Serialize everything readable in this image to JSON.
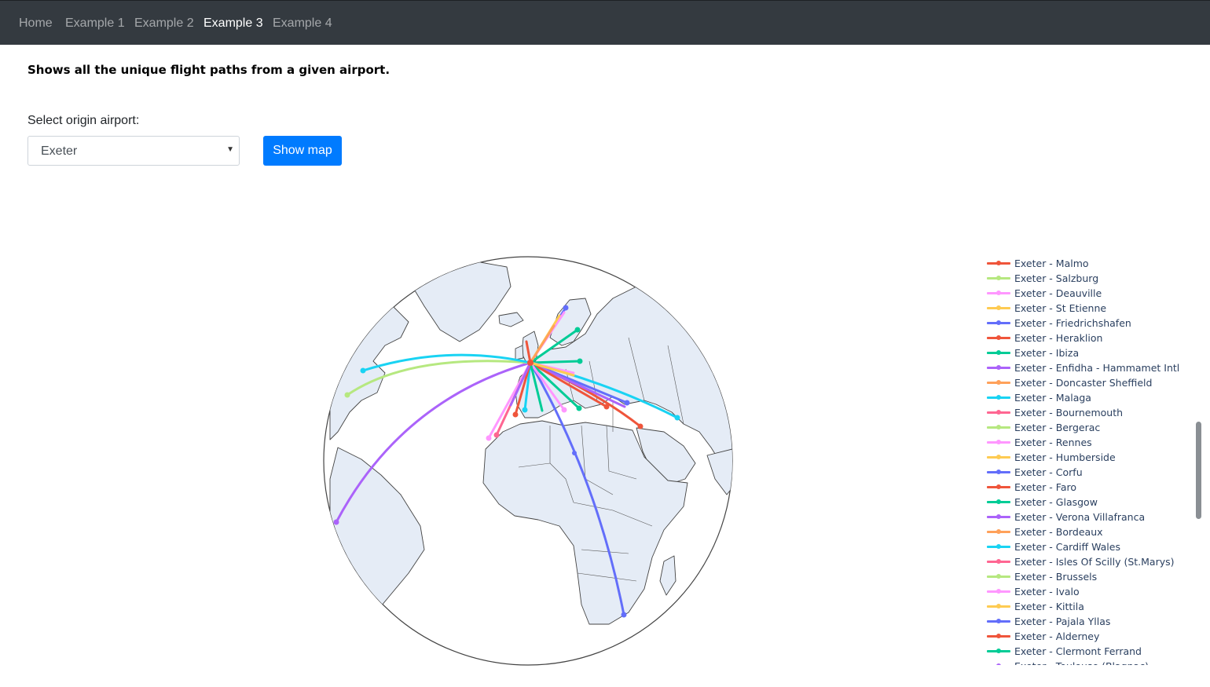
{
  "nav": {
    "items": [
      "Home",
      "Example 1",
      "Example 2",
      "Example 3",
      "Example 4"
    ],
    "active": "Example 3"
  },
  "page": {
    "description": "Shows all the unique flight paths from a given airport.",
    "select_label": "Select origin airport:",
    "select_value": "Exeter",
    "button_label": "Show map"
  },
  "map": {
    "projection": "orthographic",
    "land_color": "#e5ecf6",
    "border_color": "#444444",
    "origin": "Exeter"
  },
  "legend": {
    "items": [
      {
        "label": "Exeter - Malmo",
        "color": "#ef553b"
      },
      {
        "label": "Exeter - Salzburg",
        "color": "#b6e880"
      },
      {
        "label": "Exeter - Deauville",
        "color": "#ff97ff"
      },
      {
        "label": "Exeter - St Etienne",
        "color": "#fecb52"
      },
      {
        "label": "Exeter - Friedrichshafen",
        "color": "#636efa"
      },
      {
        "label": "Exeter - Heraklion",
        "color": "#ef553b"
      },
      {
        "label": "Exeter - Ibiza",
        "color": "#00cc96"
      },
      {
        "label": "Exeter - Enfidha - Hammamet Intl",
        "color": "#ab63fa"
      },
      {
        "label": "Exeter - Doncaster Sheffield",
        "color": "#ffa15a"
      },
      {
        "label": "Exeter - Malaga",
        "color": "#19d3f3"
      },
      {
        "label": "Exeter - Bournemouth",
        "color": "#ff6692"
      },
      {
        "label": "Exeter - Bergerac",
        "color": "#b6e880"
      },
      {
        "label": "Exeter - Rennes",
        "color": "#ff97ff"
      },
      {
        "label": "Exeter - Humberside",
        "color": "#fecb52"
      },
      {
        "label": "Exeter - Corfu",
        "color": "#636efa"
      },
      {
        "label": "Exeter - Faro",
        "color": "#ef553b"
      },
      {
        "label": "Exeter - Glasgow",
        "color": "#00cc96"
      },
      {
        "label": "Exeter - Verona Villafranca",
        "color": "#ab63fa"
      },
      {
        "label": "Exeter - Bordeaux",
        "color": "#ffa15a"
      },
      {
        "label": "Exeter - Cardiff Wales",
        "color": "#19d3f3"
      },
      {
        "label": "Exeter - Isles Of Scilly (St.Marys)",
        "color": "#ff6692"
      },
      {
        "label": "Exeter - Brussels",
        "color": "#b6e880"
      },
      {
        "label": "Exeter - Ivalo",
        "color": "#ff97ff"
      },
      {
        "label": "Exeter - Kittila",
        "color": "#fecb52"
      },
      {
        "label": "Exeter - Pajala Yllas",
        "color": "#636efa"
      },
      {
        "label": "Exeter - Alderney",
        "color": "#ef553b"
      },
      {
        "label": "Exeter - Clermont Ferrand",
        "color": "#00cc96"
      },
      {
        "label": "Exeter - Toulouse (Blagnac)",
        "color": "#ab63fa"
      }
    ]
  }
}
